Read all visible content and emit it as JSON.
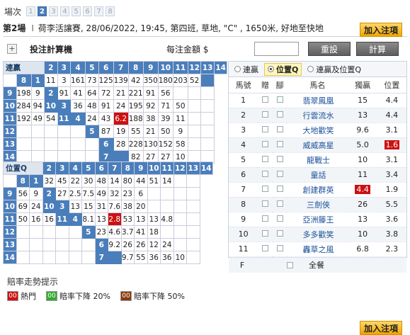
{
  "race_selector": {
    "label": "場次",
    "races": [
      "1",
      "2",
      "3",
      "4",
      "5",
      "6",
      "7",
      "8"
    ],
    "active": "2"
  },
  "race_info": {
    "race_no": "第2場",
    "sep": "I",
    "details": "荷李活讓賽, 28/06/2022, 19:45, 第四班, 草地, \"C\" , 1650米, 好地至快地"
  },
  "add_bet_label": "加入注項",
  "calculator": {
    "title": "投注計算機",
    "amount_label": "每注金額 $",
    "amount_value": "",
    "reset": "重設",
    "calc": "計算",
    "plus": "+"
  },
  "quinella": {
    "corner": "連贏",
    "cols": [
      "2",
      "3",
      "4",
      "5",
      "6",
      "7",
      "8",
      "9",
      "10",
      "11",
      "12",
      "13",
      "14"
    ],
    "rows": [
      [
        "8",
        "1",
        "11",
        "3",
        "161",
        "73",
        "125",
        "139",
        "42",
        "350",
        "180",
        "203",
        "52",
        ""
      ],
      [
        "9",
        "198",
        "9",
        "2",
        "91",
        "41",
        "64",
        "72",
        "21",
        "221",
        "91",
        "56",
        ""
      ],
      [
        "10",
        "284",
        "94",
        "10",
        "3",
        "36",
        "48",
        "91",
        "24",
        "195",
        "92",
        "71",
        "50",
        ""
      ],
      [
        "11",
        "192",
        "49",
        "54",
        "11",
        "4",
        "24",
        "43",
        "6.2",
        "188",
        "38",
        "39",
        "11",
        ""
      ],
      [
        "12",
        "",
        "",
        "",
        "",
        "5",
        "87",
        "19",
        "55",
        "21",
        "50",
        "9",
        ""
      ],
      [
        "13",
        "",
        "",
        "",
        "",
        "6",
        "28",
        "228",
        "130",
        "152",
        "58",
        ""
      ],
      [
        "14",
        "",
        "",
        "",
        "",
        "7",
        "82",
        "27",
        "27",
        "10",
        ""
      ]
    ]
  },
  "place_q": {
    "corner": "位置Q",
    "cols": [
      "2",
      "3",
      "4",
      "5",
      "6",
      "7",
      "8",
      "9",
      "10",
      "11",
      "12",
      "13",
      "14"
    ],
    "rows": [
      [
        "8",
        "1",
        "32",
        "45",
        "22",
        "30",
        "48",
        "14",
        "80",
        "44",
        "51",
        "14"
      ],
      [
        "9",
        "56",
        "9",
        "2",
        "27",
        "2.5",
        "7.5",
        "49",
        "32",
        "23",
        "6"
      ],
      [
        "10",
        "69",
        "24",
        "10",
        "3",
        "13",
        "15",
        "31",
        "7.6",
        "38",
        "20",
        "15"
      ],
      [
        "11",
        "50",
        "16",
        "16",
        "11",
        "4",
        "8.1",
        "13",
        "2.8",
        "53",
        "13",
        "13",
        "4.8"
      ],
      [
        "12",
        "",
        "",
        "",
        "",
        "5",
        "23",
        "4.6",
        "3.7",
        "41",
        "18",
        "8.9"
      ],
      [
        "13",
        "",
        "",
        "",
        "",
        "6",
        "9.2",
        "26",
        "26",
        "12",
        "24"
      ],
      [
        "14",
        "",
        "",
        "",
        "",
        "7",
        "9.7",
        "55",
        "36",
        "36",
        "10"
      ]
    ]
  },
  "pool_tabs": [
    "連贏",
    "位置Q",
    "連贏及位置Q"
  ],
  "pool_selected": "位置Q",
  "horse_table": {
    "headers": [
      "馬號",
      "贈",
      "腳",
      "馬名",
      "獨贏",
      "位置"
    ],
    "rows": [
      {
        "no": "1",
        "name": "翡翠鳳凰",
        "win": "15",
        "place": "4.4"
      },
      {
        "no": "2",
        "name": "行雲流水",
        "win": "13",
        "place": "4.4"
      },
      {
        "no": "3",
        "name": "大地歡笑",
        "win": "9.6",
        "place": "3.1"
      },
      {
        "no": "4",
        "name": "威威高星",
        "win": "5.0",
        "place": "1.6"
      },
      {
        "no": "5",
        "name": "龍戰士",
        "win": "10",
        "place": "3.1"
      },
      {
        "no": "6",
        "name": "童話",
        "win": "11",
        "place": "3.4"
      },
      {
        "no": "7",
        "name": "創建群英",
        "win": "4.4",
        "place": "1.9"
      },
      {
        "no": "8",
        "name": "三劍俠",
        "win": "26",
        "place": "5.5"
      },
      {
        "no": "9",
        "name": "亞洲籐王",
        "win": "13",
        "place": "3.6"
      },
      {
        "no": "10",
        "name": "多多歡笑",
        "win": "10",
        "place": "3.8"
      },
      {
        "no": "11",
        "name": "轟草之風",
        "win": "6.8",
        "place": "2.3"
      }
    ],
    "field_label": "F",
    "field_name": "全餐"
  },
  "legend": {
    "title": "賠率走勢提示",
    "items": [
      {
        "box": "00",
        "label": "熱門",
        "color": "#cc1111"
      },
      {
        "box": "00",
        "label": "賠率下降 20%",
        "color": "#33aa33"
      },
      {
        "box": "00",
        "label": "賠率下降 50%",
        "color": "#8b3a0e"
      }
    ]
  }
}
